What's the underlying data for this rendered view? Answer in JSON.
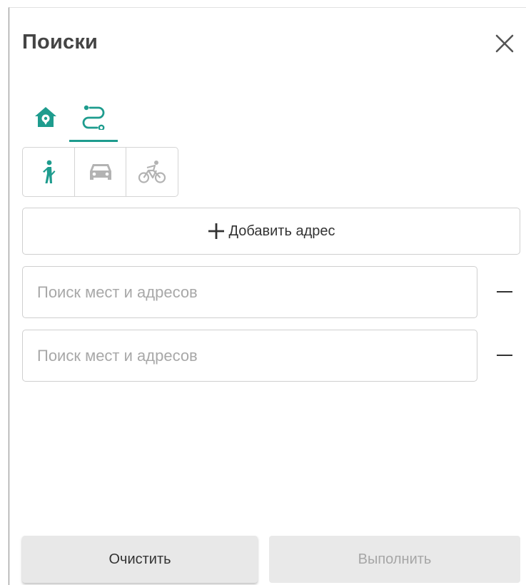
{
  "panel": {
    "title": "Поиски"
  },
  "tabs": [
    {
      "icon": "home-pin-icon",
      "active": false
    },
    {
      "icon": "route-icon",
      "active": true
    }
  ],
  "travel_modes": [
    {
      "icon": "walk-icon",
      "selected": true
    },
    {
      "icon": "car-icon",
      "selected": false
    },
    {
      "icon": "bicycle-icon",
      "selected": false
    }
  ],
  "add_address": {
    "label": "Добавить адрес"
  },
  "inputs": [
    {
      "value": "",
      "placeholder": "Поиск мест и адресов"
    },
    {
      "value": "",
      "placeholder": "Поиск мест и адресов"
    }
  ],
  "footer": {
    "clear_label": "Очистить",
    "run_label": "Выполнить"
  },
  "colors": {
    "accent": "#1e9c8e",
    "inactive_icon": "#b3b3b3",
    "disabled_text": "#a6a6a6"
  }
}
